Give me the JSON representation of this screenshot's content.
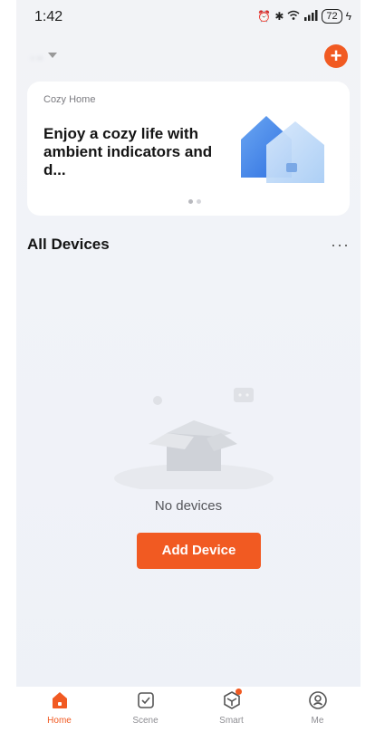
{
  "status": {
    "time": "1:42",
    "battery": "72"
  },
  "header": {
    "home_name": ". .."
  },
  "banner": {
    "label": "Cozy Home",
    "headline": "Enjoy a cozy life with ambient indicators and d...",
    "page_count": 2,
    "active_page": 1
  },
  "devices": {
    "title": "All Devices",
    "more": "···",
    "empty_text": "No devices",
    "add_button": "Add Device"
  },
  "tabs": [
    {
      "label": "Home",
      "icon": "home-icon",
      "active": true
    },
    {
      "label": "Scene",
      "icon": "scene-check-icon",
      "active": false
    },
    {
      "label": "Smart",
      "icon": "smart-cube-icon",
      "active": false
    },
    {
      "label": "Me",
      "icon": "profile-icon",
      "active": false
    }
  ],
  "colors": {
    "accent": "#f15a22",
    "background": "#f2f3f6",
    "card": "#ffffff"
  }
}
